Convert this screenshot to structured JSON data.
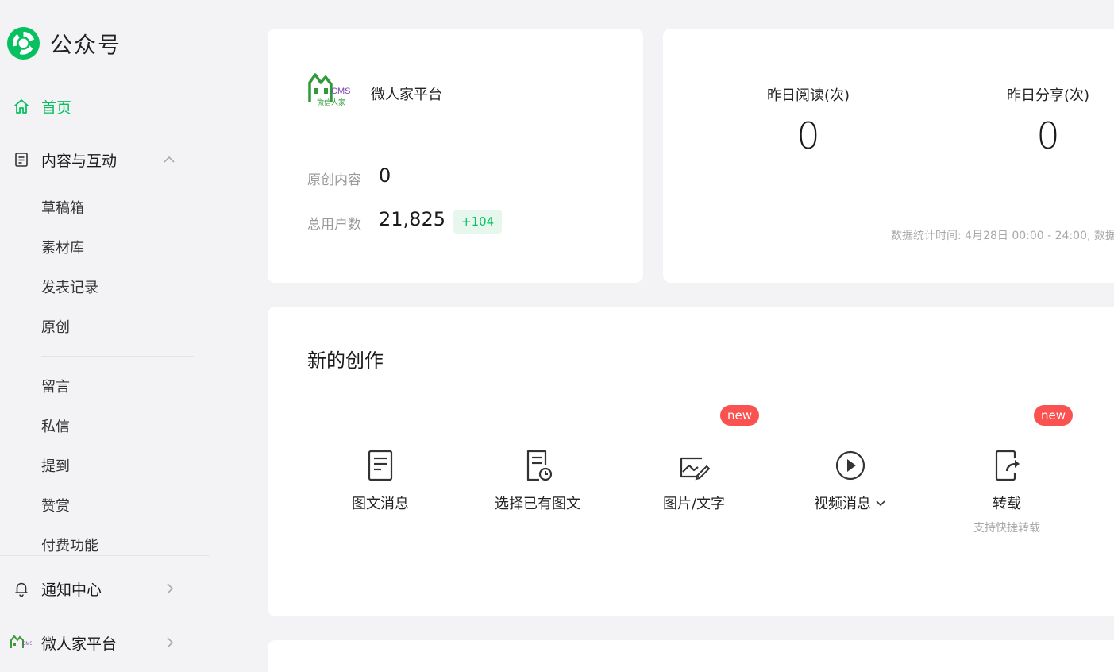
{
  "brand": {
    "name": "公众号",
    "accent_color": "#07c160"
  },
  "sidebar": {
    "home": {
      "label": "首页",
      "icon": "home-icon"
    },
    "content": {
      "label": "内容与互动",
      "icon": "document-icon",
      "items_group1": [
        "草稿箱",
        "素材库",
        "发表记录",
        "原创"
      ],
      "items_group2": [
        "留言",
        "私信",
        "提到",
        "赞赏",
        "付费功能"
      ]
    },
    "notifications": {
      "label": "通知中心",
      "icon": "bell-icon"
    },
    "account": {
      "label": "微人家平台",
      "icon": "account-logo-icon"
    }
  },
  "account_card": {
    "logo_text": "CMS",
    "logo_subtext": "微信人家",
    "name": "微人家平台",
    "original_label": "原创内容",
    "original_value": "0",
    "users_label": "总用户数",
    "users_value": "21,825",
    "users_gain": "+104"
  },
  "stats_card": {
    "reads_label": "昨日阅读(次)",
    "reads_value": "0",
    "shares_label": "昨日分享(次)",
    "shares_value": "0",
    "footnote": "数据统计时间: 4月28日 00:00 - 24:00, 数据"
  },
  "create_card": {
    "title": "新的创作",
    "items": [
      {
        "label": "图文消息",
        "icon": "article-icon",
        "badge": ""
      },
      {
        "label": "选择已有图文",
        "icon": "existing-article-icon",
        "badge": ""
      },
      {
        "label": "图片/文字",
        "icon": "image-text-icon",
        "badge": "new"
      },
      {
        "label": "视频消息",
        "icon": "video-play-icon",
        "badge": ""
      },
      {
        "label": "转载",
        "icon": "repost-icon",
        "badge": "new",
        "sub": "支持快捷转载"
      }
    ]
  }
}
